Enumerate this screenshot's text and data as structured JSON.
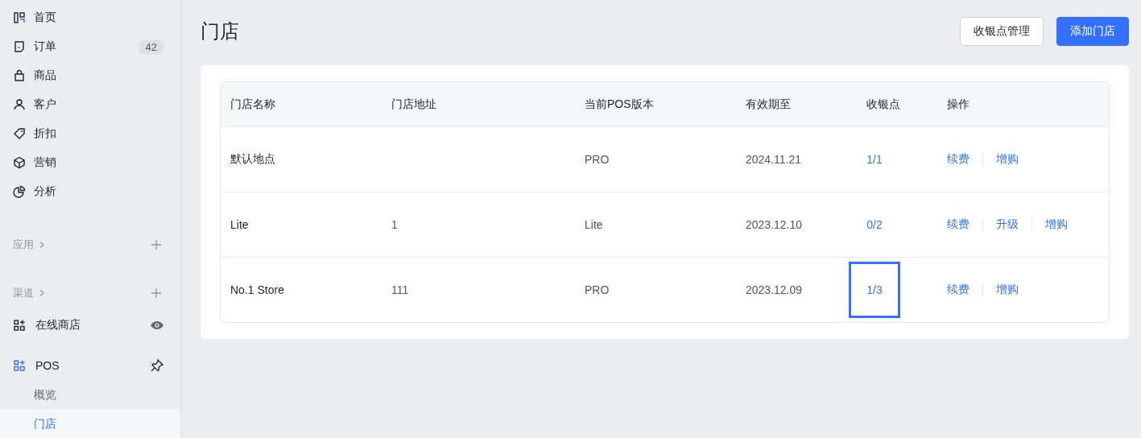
{
  "sidebar": {
    "nav_items": [
      {
        "label": "首页"
      },
      {
        "label": "订单",
        "badge": "42"
      },
      {
        "label": "商品"
      },
      {
        "label": "客户"
      },
      {
        "label": "折扣"
      },
      {
        "label": "营销"
      },
      {
        "label": "分析"
      }
    ],
    "sections": [
      {
        "label": "应用"
      },
      {
        "label": "渠道",
        "items": [
          {
            "label": "在线商店"
          }
        ]
      }
    ],
    "pos": {
      "label": "POS",
      "children": [
        {
          "label": "概览",
          "selected": false
        },
        {
          "label": "门店",
          "selected": true
        }
      ]
    }
  },
  "page": {
    "title": "门店",
    "buttons": [
      {
        "label": "收银点管理",
        "kind": "secondary"
      },
      {
        "label": "添加门店",
        "kind": "primary"
      }
    ]
  },
  "table": {
    "columns": [
      "门店名称",
      "门店地址",
      "当前POS版本",
      "有效期至",
      "收银点",
      "操作"
    ],
    "rows": [
      {
        "name": "默认地点",
        "version": "PRO",
        "expires": "2024.11.21",
        "registers": {
          "text": "1/1",
          "focused": false
        },
        "actions": [
          "续费",
          "增购"
        ]
      },
      {
        "name": "Lite",
        "address": "1",
        "version": "Lite",
        "expires": "2023.12.10",
        "registers": {
          "text": "0/2",
          "focused": false
        },
        "actions": [
          "续费",
          "升级",
          "增购"
        ]
      },
      {
        "name": "No.1 Store",
        "address": "111",
        "version": "PRO",
        "expires": "2023.12.09",
        "registers": {
          "text": "1/3",
          "focused": true
        },
        "actions": [
          "续费",
          "增购"
        ]
      }
    ]
  }
}
